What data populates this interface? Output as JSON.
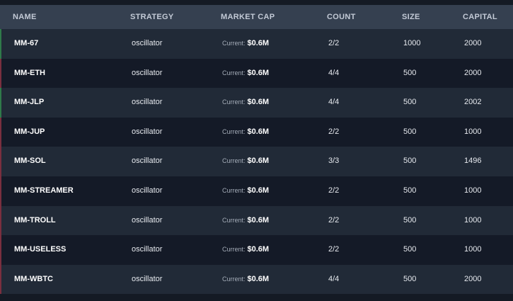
{
  "table": {
    "columns": [
      "NAME",
      "STRATEGY",
      "MARKET CAP",
      "COUNT",
      "SIZE",
      "CAPITAL"
    ],
    "market_cap_prefix": "Current:",
    "rows": [
      {
        "name": "MM-67",
        "strategy": "oscillator",
        "market_cap": "$0.6M",
        "count": "2/2",
        "size": "1000",
        "capital": "2000",
        "accent": "green"
      },
      {
        "name": "MM-ETH",
        "strategy": "oscillator",
        "market_cap": "$0.6M",
        "count": "4/4",
        "size": "500",
        "capital": "2000",
        "accent": "red"
      },
      {
        "name": "MM-JLP",
        "strategy": "oscillator",
        "market_cap": "$0.6M",
        "count": "4/4",
        "size": "500",
        "capital": "2002",
        "accent": "green"
      },
      {
        "name": "MM-JUP",
        "strategy": "oscillator",
        "market_cap": "$0.6M",
        "count": "2/2",
        "size": "500",
        "capital": "1000",
        "accent": "red"
      },
      {
        "name": "MM-SOL",
        "strategy": "oscillator",
        "market_cap": "$0.6M",
        "count": "3/3",
        "size": "500",
        "capital": "1496",
        "accent": "red"
      },
      {
        "name": "MM-STREAMER",
        "strategy": "oscillator",
        "market_cap": "$0.6M",
        "count": "2/2",
        "size": "500",
        "capital": "1000",
        "accent": "red"
      },
      {
        "name": "MM-TROLL",
        "strategy": "oscillator",
        "market_cap": "$0.6M",
        "count": "2/2",
        "size": "500",
        "capital": "1000",
        "accent": "red"
      },
      {
        "name": "MM-USELESS",
        "strategy": "oscillator",
        "market_cap": "$0.6M",
        "count": "2/2",
        "size": "500",
        "capital": "1000",
        "accent": "red"
      },
      {
        "name": "MM-WBTC",
        "strategy": "oscillator",
        "market_cap": "$0.6M",
        "count": "4/4",
        "size": "500",
        "capital": "2000",
        "accent": "red"
      }
    ]
  },
  "colors": {
    "header_bg": "#354050",
    "row_odd_bg": "#212a37",
    "row_even_bg": "#141a27",
    "accent_green": "#2f7a4a",
    "accent_red": "#7a2f3f"
  }
}
